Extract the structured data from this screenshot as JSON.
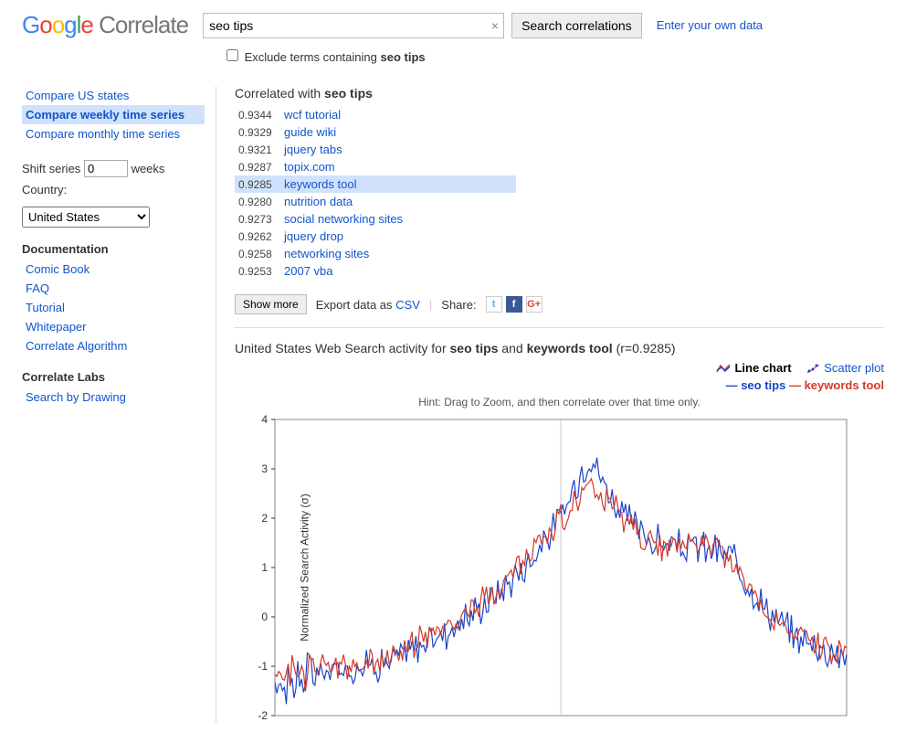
{
  "header": {
    "logo_google": "Google",
    "logo_corr": "Correlate",
    "search_value": "seo tips",
    "search_button": "Search correlations",
    "own_data": "Enter your own data",
    "exclude_prefix": "Exclude terms containing ",
    "exclude_term": "seo tips"
  },
  "sidebar": {
    "compare": [
      {
        "label": "Compare US states",
        "active": false
      },
      {
        "label": "Compare weekly time series",
        "active": true
      },
      {
        "label": "Compare monthly time series",
        "active": false
      }
    ],
    "shift_label_pre": "Shift series",
    "shift_value": "0",
    "shift_label_post": "weeks",
    "country_label": "Country:",
    "country_value": "United States",
    "doc_heading": "Documentation",
    "doc_links": [
      "Comic Book",
      "FAQ",
      "Tutorial",
      "Whitepaper",
      "Correlate Algorithm"
    ],
    "labs_heading": "Correlate Labs",
    "labs_links": [
      "Search by Drawing"
    ]
  },
  "results": {
    "heading_prefix": "Correlated with ",
    "heading_term": "seo tips",
    "items": [
      {
        "r": "0.9344",
        "term": "wcf tutorial",
        "sel": false
      },
      {
        "r": "0.9329",
        "term": "guide wiki",
        "sel": false
      },
      {
        "r": "0.9321",
        "term": "jquery tabs",
        "sel": false
      },
      {
        "r": "0.9287",
        "term": "topix.com",
        "sel": false
      },
      {
        "r": "0.9285",
        "term": "keywords tool",
        "sel": true
      },
      {
        "r": "0.9280",
        "term": "nutrition data",
        "sel": false
      },
      {
        "r": "0.9273",
        "term": "social networking sites",
        "sel": false
      },
      {
        "r": "0.9262",
        "term": "jquery drop",
        "sel": false
      },
      {
        "r": "0.9258",
        "term": "networking sites",
        "sel": false
      },
      {
        "r": "0.9253",
        "term": "2007 vba",
        "sel": false
      }
    ],
    "show_more": "Show more",
    "export_prefix": "Export data as ",
    "export_csv": "CSV",
    "share_label": "Share:"
  },
  "chart": {
    "title_prefix": "United States Web Search activity for ",
    "title_t1": "seo tips",
    "title_mid": " and ",
    "title_t2": "keywords tool",
    "title_r": " (r=0.9285)",
    "tab_line": "Line chart",
    "tab_scatter": "Scatter plot",
    "legend_s1": "seo tips",
    "legend_s2": "keywords tool",
    "hint": "Hint: Drag to Zoom, and then correlate over that time only.",
    "ylabel": "Normalized Search Activity (σ)",
    "yticks": [
      "4",
      "3",
      "2",
      "1",
      "0",
      "-1",
      "-2"
    ]
  },
  "chart_data": {
    "type": "line",
    "ylabel": "Normalized Search Activity (σ)",
    "ylim": [
      -2,
      4
    ],
    "series": [
      {
        "name": "seo tips",
        "color": "#1a44c9"
      },
      {
        "name": "keywords tool",
        "color": "#d23a2a"
      }
    ],
    "notes": "Approximate shape: both series start near -1 to -1.5 on the left, rise gradually through 0, peak around 2.5–3.5 near the middle (seo tips slightly higher peak ~3.5), then decline with fluctuation toward roughly -0.7 to -1 on the right. Correlation r=0.9285.",
    "approx_values": {
      "x_fraction": [
        0.0,
        0.05,
        0.1,
        0.15,
        0.2,
        0.25,
        0.3,
        0.35,
        0.4,
        0.45,
        0.5,
        0.55,
        0.6,
        0.65,
        0.7,
        0.75,
        0.8,
        0.85,
        0.9,
        0.95,
        1.0
      ],
      "seo_tips": [
        -1.4,
        -1.2,
        -1.1,
        -1.0,
        -0.9,
        -0.6,
        -0.3,
        0.1,
        0.6,
        1.2,
        2.0,
        3.3,
        2.2,
        1.6,
        1.4,
        1.4,
        1.2,
        0.3,
        -0.3,
        -0.6,
        -0.8
      ],
      "keywords_tool": [
        -1.1,
        -1.1,
        -1.0,
        -1.0,
        -0.8,
        -0.5,
        -0.2,
        0.2,
        0.7,
        1.3,
        2.0,
        2.6,
        2.1,
        1.5,
        1.4,
        1.6,
        1.1,
        0.2,
        -0.3,
        -0.6,
        -0.7
      ]
    }
  }
}
